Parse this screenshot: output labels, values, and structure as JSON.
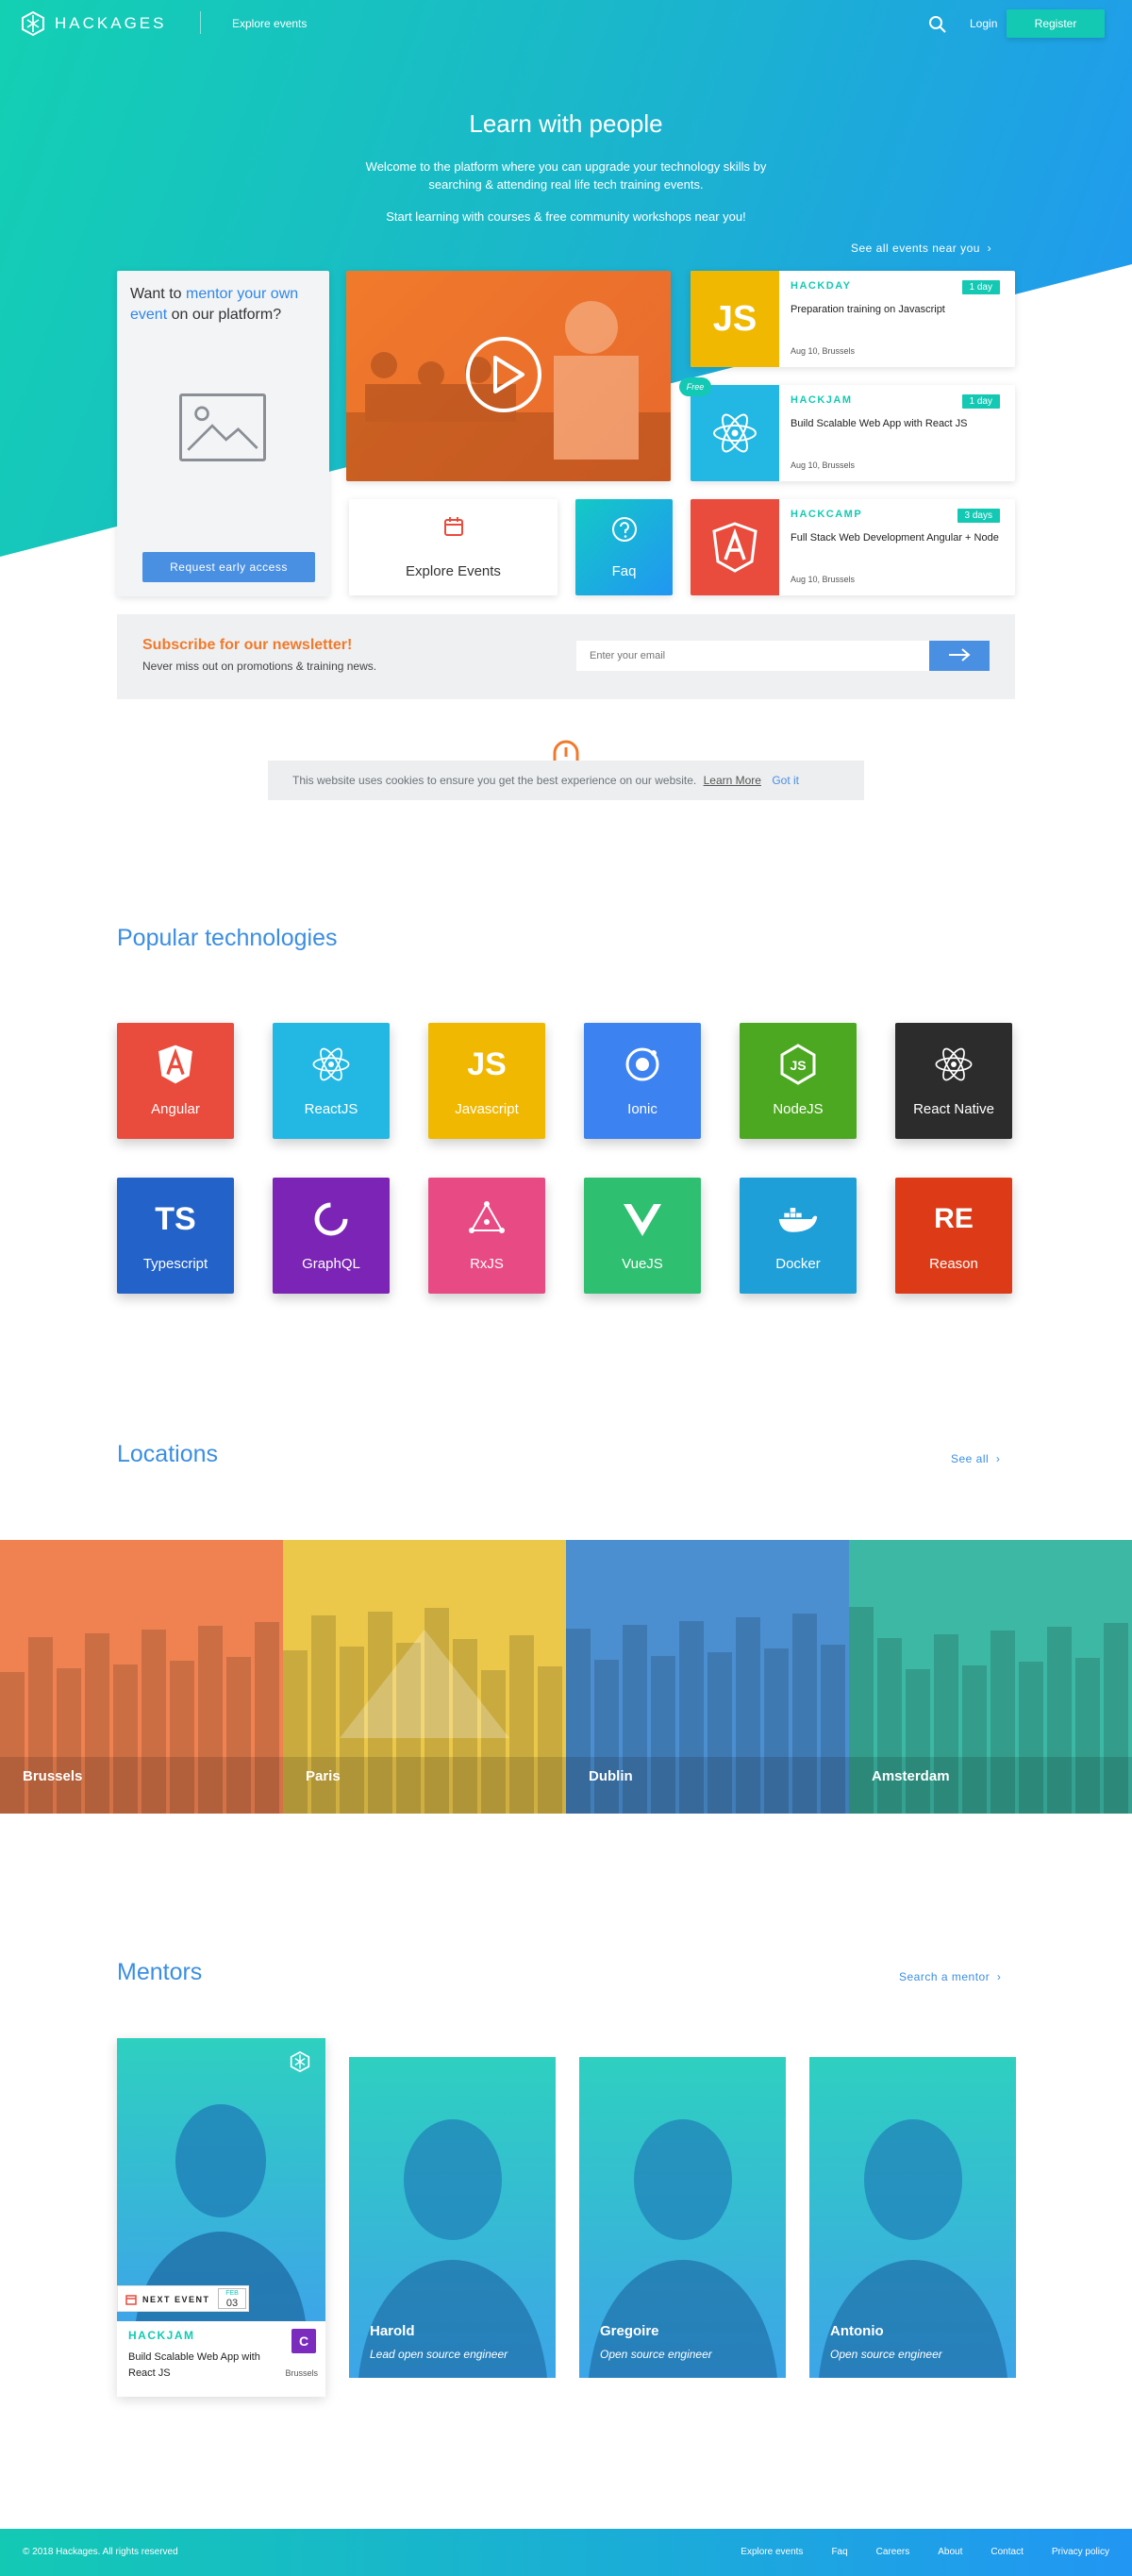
{
  "header": {
    "logo_text": "HACKAGES",
    "nav_explore": "Explore events",
    "login": "Login",
    "register": "Register"
  },
  "hero": {
    "title": "Learn with people",
    "subtitle": "Welcome to the platform where you can upgrade your technology skills by searching & attending real life tech training events.",
    "subtitle2": "Start learning with courses & free community workshops near you!",
    "see_all_near": "See all events near you"
  },
  "mentor_promo": {
    "q_prefix": "Want to ",
    "q_highlight": "mentor your own event",
    "q_suffix": " on our platform?",
    "button": "Request early access"
  },
  "tiles": {
    "explore": "Explore Events",
    "faq": "Faq"
  },
  "events": [
    {
      "type": "HACKDAY",
      "badge": "1 day",
      "title": "Preparation training on Javascript",
      "meta": "Aug 10, Brussels",
      "thumb": "JS",
      "color": "#f0b800"
    },
    {
      "type": "HACKJAM",
      "badge": "1 day",
      "title": "Build Scalable Web App with React JS",
      "meta": "Aug 10, Brussels",
      "thumb": "react",
      "color": "#22b8e3",
      "free": "Free"
    },
    {
      "type": "HACKCAMP",
      "badge": "3 days",
      "title": "Full Stack Web Development Angular + Node",
      "meta": "Aug 10, Brussels",
      "thumb": "angular",
      "color": "#e94b3c"
    }
  ],
  "newsletter": {
    "title": "Subscribe for our newsletter!",
    "subtitle": "Never miss out on promotions & training news.",
    "placeholder": "Enter your email"
  },
  "cookie": {
    "text": "This website uses cookies to ensure you get the best experience on our website.",
    "learn_more": "Learn More",
    "got_it": "Got it"
  },
  "technologies": {
    "title": "Popular technologies",
    "items": [
      {
        "name": "Angular",
        "icon": "angular-icon",
        "color": "#e94b3c"
      },
      {
        "name": "ReactJS",
        "icon": "react-icon",
        "color": "#22b8e3"
      },
      {
        "name": "Javascript",
        "icon": "js-icon",
        "color": "#f0b800"
      },
      {
        "name": "Ionic",
        "icon": "ionic-icon",
        "color": "#3c82f0"
      },
      {
        "name": "NodeJS",
        "icon": "node-icon",
        "color": "#4ca820"
      },
      {
        "name": "React Native",
        "icon": "react-icon",
        "color": "#2c2c2c"
      },
      {
        "name": "Typescript",
        "icon": "ts-icon",
        "color": "#2362c9"
      },
      {
        "name": "GraphQL",
        "icon": "graphql-icon",
        "color": "#7b24b5"
      },
      {
        "name": "RxJS",
        "icon": "rxjs-icon",
        "color": "#e84a84"
      },
      {
        "name": "VueJS",
        "icon": "vue-icon",
        "color": "#2fbf70"
      },
      {
        "name": "Docker",
        "icon": "docker-icon",
        "color": "#1e9fd8"
      },
      {
        "name": "Reason",
        "icon": "reason-icon",
        "color": "#dd3b18"
      }
    ]
  },
  "locations": {
    "title": "Locations",
    "see_all": "See all",
    "items": [
      {
        "name": "Brussels",
        "color": "#ef8250"
      },
      {
        "name": "Paris",
        "color": "#ecc84a"
      },
      {
        "name": "Dublin",
        "color": "#4b8fd1"
      },
      {
        "name": "Amsterdam",
        "color": "#3db8a4"
      }
    ]
  },
  "mentors": {
    "title": "Mentors",
    "search": "Search a mentor",
    "featured": {
      "next_event": "NEXT EVENT",
      "month": "FEB",
      "day": "03",
      "type": "HACKJAM",
      "title": "Build Scalable Web App with React JS",
      "city": "Brussels",
      "logo": "C"
    },
    "items": [
      {
        "name": "Harold",
        "role": "Lead open source engineer"
      },
      {
        "name": "Gregoire",
        "role": "Open source engineer"
      },
      {
        "name": "Antonio",
        "role": "Open source engineer"
      }
    ]
  },
  "footer": {
    "copyright": "© 2018 Hackages. All rights reserved",
    "links": [
      "Explore events",
      "Faq",
      "Careers",
      "About",
      "Contact",
      "Privacy policy"
    ]
  }
}
